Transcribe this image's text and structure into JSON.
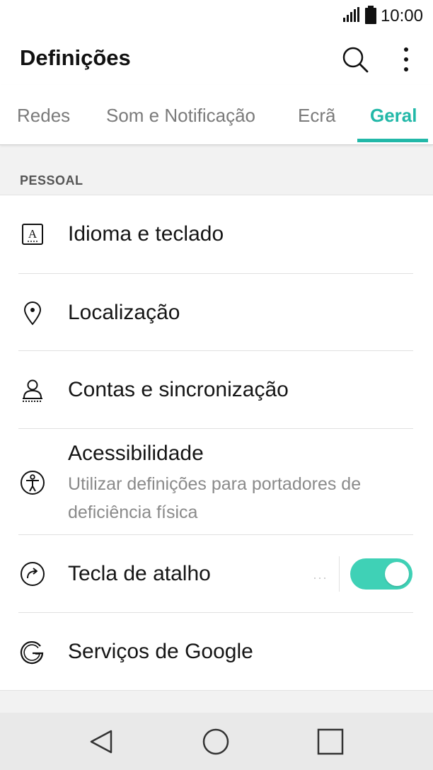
{
  "status_bar": {
    "time": "10:00",
    "signal_icon": "signal-bars-icon",
    "battery_icon": "battery-icon"
  },
  "app_bar": {
    "title": "Definições",
    "search_icon": "search-icon",
    "more_icon": "more-vert-icon"
  },
  "tabs": [
    {
      "label": "Redes",
      "active": false
    },
    {
      "label": "Som e Notificação",
      "active": false
    },
    {
      "label": "Ecrã",
      "active": false
    },
    {
      "label": "Geral",
      "active": true
    }
  ],
  "section": {
    "header": "PESSOAL"
  },
  "items": [
    {
      "title": "Idioma e teclado",
      "icon": "language-icon"
    },
    {
      "title": "Localização",
      "icon": "location-pin-icon"
    },
    {
      "title": "Contas e sincronização",
      "icon": "accounts-icon"
    },
    {
      "title": "Acessibilidade",
      "subtitle": "Utilizar definições para portadores de deficiência física",
      "icon": "accessibility-icon"
    },
    {
      "title": "Tecla de atalho",
      "icon": "shortcut-key-icon",
      "more": "···",
      "toggle_on": true
    },
    {
      "title": "Serviços de Google",
      "icon": "google-icon"
    }
  ],
  "nav_bar": {
    "back_icon": "back-icon",
    "home_icon": "home-icon",
    "recents_icon": "recents-icon"
  },
  "colors": {
    "accent": "#22b8a8",
    "toggle": "#3fd1b6"
  }
}
